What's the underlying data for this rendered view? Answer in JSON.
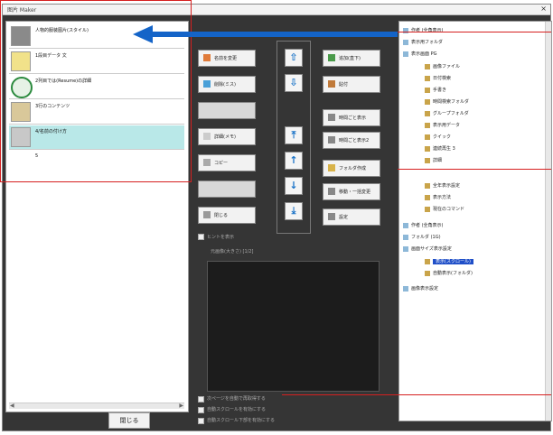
{
  "window": {
    "title": "图片 Maker",
    "close_glyph": "×"
  },
  "left_list": {
    "items": [
      {
        "label": "人物的服装图片(スタイル)",
        "selected": false
      },
      {
        "label": "1段目データ 文",
        "selected": false
      },
      {
        "label": "2列目では(Resume)の詳細",
        "selected": false
      },
      {
        "label": "3行のコンテンツ",
        "selected": false
      },
      {
        "label": "4/名前の付け方",
        "selected": true
      }
    ],
    "trailing_label": "5",
    "scroll_left": "◀",
    "scroll_right": "▶"
  },
  "close_button": "閉じる",
  "buttons_left": [
    {
      "label": "名前を変更",
      "disabled": false
    },
    {
      "label": "削除(ミス)",
      "disabled": false
    },
    {
      "label": "",
      "disabled": true
    },
    {
      "label": "詳細(メモ)",
      "disabled": false
    },
    {
      "label": "コピー",
      "disabled": false
    },
    {
      "label": "",
      "disabled": true
    },
    {
      "label": "閉じる",
      "disabled": false
    }
  ],
  "arrow_buttons": [
    "⇧",
    "⇩",
    "⤒",
    "↑",
    "↓",
    "⤓"
  ],
  "buttons_right": [
    {
      "label": "追加(直下)",
      "disabled": false
    },
    {
      "label": "貼付",
      "disabled": false
    },
    {
      "label": "時間ごと表示",
      "disabled": false
    },
    {
      "label": "時間ごと表示2",
      "disabled": false
    },
    {
      "label": "フォルダ作成",
      "disabled": false
    },
    {
      "label": "移動・一括変更",
      "disabled": false
    },
    {
      "label": "設定",
      "disabled": false
    }
  ],
  "options": {
    "checkbox_top": "ヒントを表示",
    "preview_label": "元画像(大きさ) [1/2]",
    "checkbox_1": "次ページを自動で再取得する",
    "checkbox_2": "自動スクロールを有効にする",
    "checkbox_3": "自動スクロール下部を有効にする"
  },
  "tree": {
    "items": [
      {
        "label": "作者 (全角表示)",
        "level": 0,
        "icon": "folder-icon",
        "selected": false
      },
      {
        "label": "表示用フォルダ",
        "level": 0,
        "icon": "folder-icon",
        "selected": false
      },
      {
        "label": "表示画面 PG",
        "level": 0,
        "icon": "folder-icon",
        "selected": false
      },
      {
        "label": "画像ファイル",
        "level": 1,
        "icon": "file-icon",
        "selected": false
      },
      {
        "label": "日付検索",
        "level": 1,
        "icon": "file-icon",
        "selected": false
      },
      {
        "label": "手書き",
        "level": 1,
        "icon": "file-icon",
        "selected": false
      },
      {
        "label": "時間検索フォルダ",
        "level": 1,
        "icon": "file-icon",
        "selected": false
      },
      {
        "label": "グループフォルダ",
        "level": 1,
        "icon": "file-icon",
        "selected": false
      },
      {
        "label": "表示用データ",
        "level": 1,
        "icon": "file-icon",
        "selected": false
      },
      {
        "label": "クイック",
        "level": 1,
        "icon": "file-icon",
        "selected": false
      },
      {
        "label": "連続再生 3",
        "level": 1,
        "icon": "file-icon",
        "selected": false
      },
      {
        "label": "詳細",
        "level": 1,
        "icon": "file-icon",
        "selected": false
      },
      {
        "label": "全年表示設定",
        "level": 1,
        "icon": "file-icon",
        "selected": false
      },
      {
        "label": "表示方法",
        "level": 1,
        "icon": "file-icon",
        "selected": false
      },
      {
        "label": "現在のコマンド",
        "level": 1,
        "icon": "file-icon",
        "selected": false
      },
      {
        "label": "作者 (全角表示)",
        "level": 0,
        "icon": "folder-icon",
        "selected": false
      },
      {
        "label": "フォルダ (1G)",
        "level": 0,
        "icon": "folder-icon",
        "selected": false
      },
      {
        "label": "画面サイズ表示設定",
        "level": 0,
        "icon": "folder-icon",
        "selected": false
      },
      {
        "label": "表示(スクロール)",
        "level": 1,
        "icon": "file-icon",
        "selected": true
      },
      {
        "label": "自動表示(フォルダ)",
        "level": 1,
        "icon": "file-icon",
        "selected": false
      },
      {
        "label": "画像表示設定",
        "level": 0,
        "icon": "folder-icon",
        "selected": false
      }
    ]
  },
  "colors": {
    "accent": "#1464c8",
    "annotation": "#d62020",
    "selection": "#b9e8e8",
    "tree_selection": "#1f4fc8"
  }
}
